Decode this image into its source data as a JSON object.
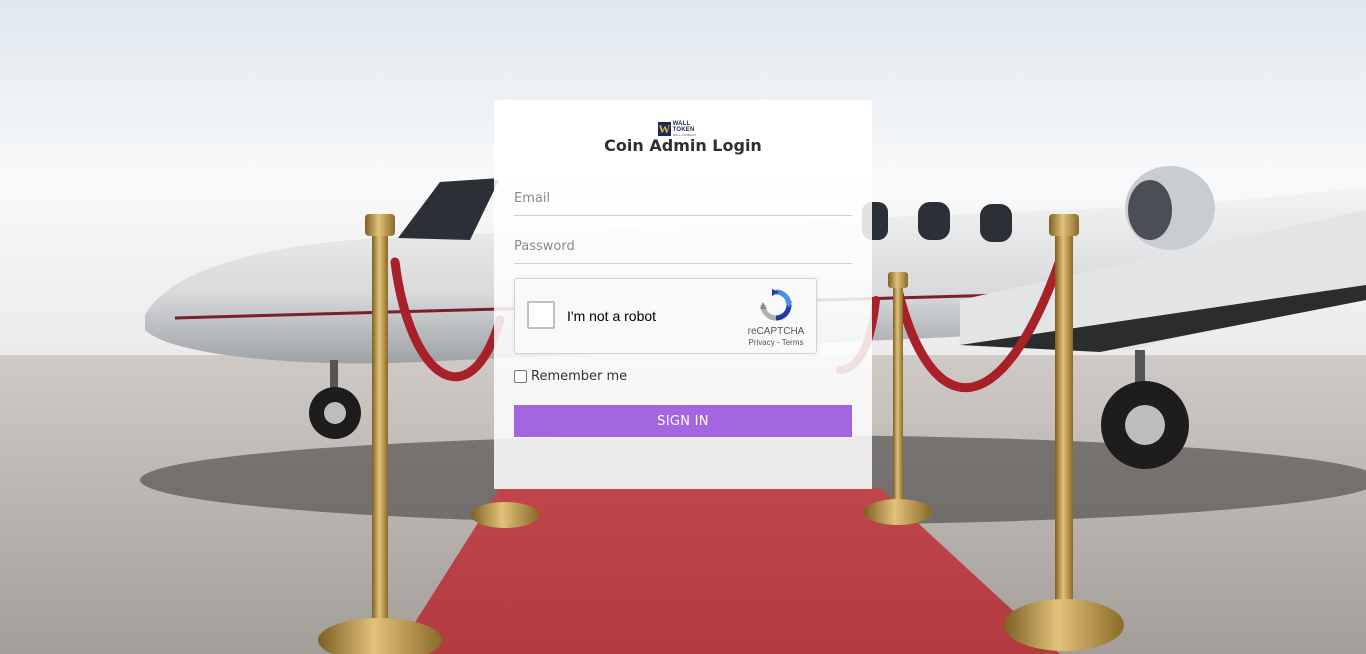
{
  "logo": {
    "line1": "WALL TOKEN",
    "line2": "WALL.COMPANY"
  },
  "login": {
    "title": "Coin Admin Login",
    "email_placeholder": "Email",
    "password_placeholder": "Password",
    "remember_label": "Remember me",
    "signin_label": "SIGN IN"
  },
  "captcha": {
    "label": "I'm not a robot",
    "brand": "reCAPTCHA",
    "privacy": "Privacy",
    "separator": " - ",
    "terms": "Terms"
  },
  "colors": {
    "accent": "#a466e0",
    "carpet": "#c0464b",
    "brass": "#b8923a"
  },
  "icons": [
    "recaptcha-icon",
    "logo-icon",
    "checkbox-icon"
  ]
}
